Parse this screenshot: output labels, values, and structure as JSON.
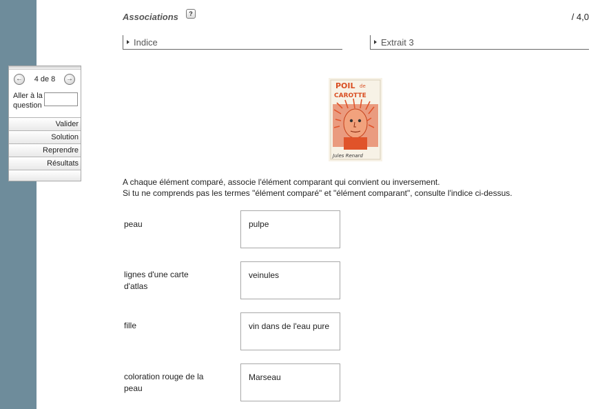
{
  "header": {
    "title": "Associations",
    "help_icon": "question-icon",
    "score": "/ 4,0"
  },
  "sections": {
    "hint": "Indice",
    "extract": "Extrait 3"
  },
  "navigation": {
    "prev_icon": "arrow-left-icon",
    "next_icon": "arrow-right-icon",
    "page_count": "4 de 8",
    "goto_label": "Aller à la question",
    "goto_value": "",
    "buttons": [
      "Valider",
      "Solution",
      "Reprendre",
      "Résultats"
    ]
  },
  "image": {
    "title_text": "POIL de CAROTTE",
    "author_text": "Jules Renard",
    "accent_color": "#e0532a"
  },
  "instructions": [
    "A chaque élément comparé, associe l'élément comparant qui convient ou inversement.",
    "Si tu ne comprends pas les termes \"élément comparé\" et \"élément comparant\", consulte l'indice ci-dessus."
  ],
  "pairs": [
    {
      "label": "peau",
      "answer": "pulpe"
    },
    {
      "label": "lignes d'une carte d'atlas",
      "answer": "veinules"
    },
    {
      "label": "fille",
      "answer": "vin dans de l'eau pure"
    },
    {
      "label": "coloration rouge de la peau",
      "answer": "Marseau"
    }
  ],
  "colors": {
    "sidebar": "#6e8c9b"
  }
}
